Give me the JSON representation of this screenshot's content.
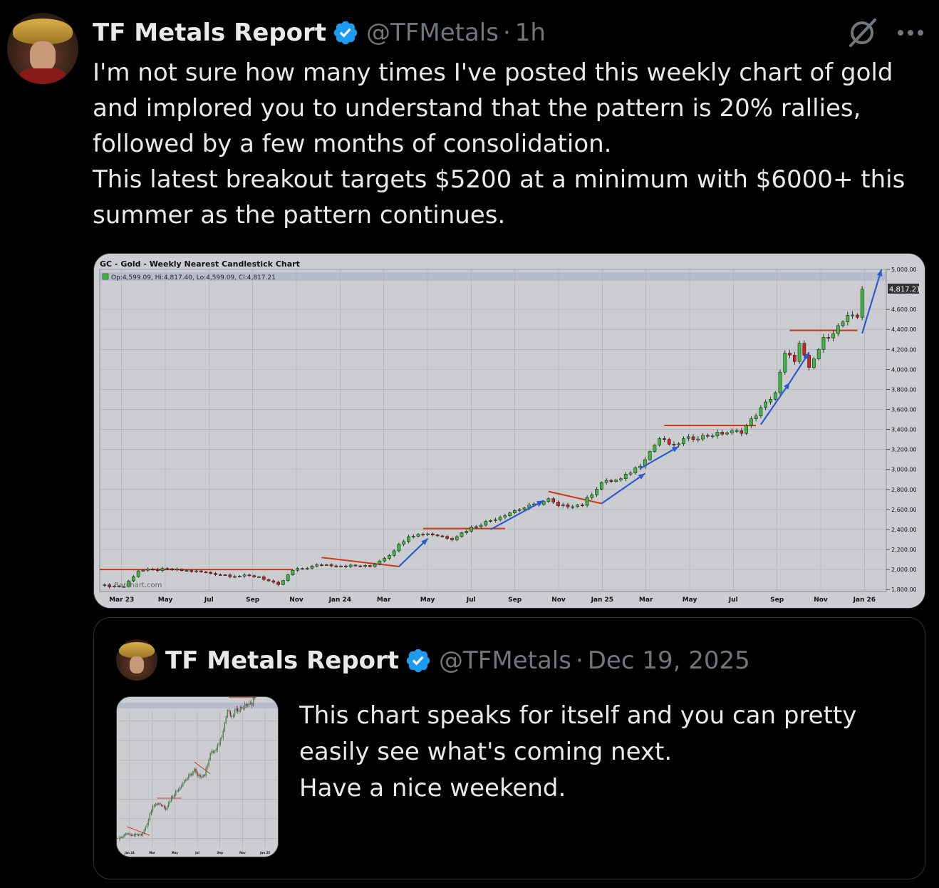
{
  "tweet": {
    "author_name": "TF Metals Report",
    "handle": "@TFMetals",
    "separator": "·",
    "time": "1h",
    "text": "I'm not sure how many times I've posted this weekly chart of gold and implored you to understand that the pattern is 20% rallies, followed by a few months of consolidation.\nThis latest breakout targets $5200 at a minimum with $6000+ this summer as the pattern continues."
  },
  "icons": {
    "verified": "verified-badge-icon",
    "grok": "grok-icon",
    "more": "more-icon"
  },
  "colors": {
    "verified": "#1d9bf0",
    "up_candle": "#3cb83c",
    "down_candle": "#d02020",
    "resistance_line": "#cc3a1a",
    "trend_arrow": "#2a5bd0",
    "muted": "#71767b"
  },
  "chart_data": {
    "type": "candlestick",
    "title": "GC - Gold - Weekly Nearest Candlestick Chart",
    "ohlc_label": "Op:4,599.09, Hi:4,817.40, Lo:4,599.09, Cl:4,817.21",
    "last_price_label": "4,817.21",
    "watermark": "Barchart.com",
    "x_tick_labels": [
      "Mar 23",
      "May",
      "Jul",
      "Sep",
      "Nov",
      "Jan 24",
      "Mar",
      "May",
      "Jul",
      "Sep",
      "Nov",
      "Jan 25",
      "Mar",
      "May",
      "Jul",
      "Sep",
      "Nov",
      "Jan 26"
    ],
    "y_tick_labels": [
      "5,000.00",
      "4,600.00",
      "4,400.00",
      "4,200.00",
      "4,000.00",
      "3,800.00",
      "3,600.00",
      "3,400.00",
      "3,200.00",
      "3,000.00",
      "2,800.00",
      "2,600.00",
      "2,400.00",
      "2,200.00",
      "2,000.00",
      "1,800.00"
    ],
    "y_ticks": [
      5000,
      4600,
      4400,
      4200,
      4000,
      3800,
      3600,
      3400,
      3200,
      3000,
      2800,
      2600,
      2400,
      2200,
      2000,
      1800
    ],
    "ylim": [
      1780,
      5000
    ],
    "weeks": 150,
    "close_anchors": [
      [
        0,
        1840
      ],
      [
        5,
        1830
      ],
      [
        8,
        1990
      ],
      [
        14,
        2000
      ],
      [
        20,
        1980
      ],
      [
        27,
        1940
      ],
      [
        33,
        1930
      ],
      [
        37,
        1840
      ],
      [
        40,
        1990
      ],
      [
        46,
        2050
      ],
      [
        50,
        2040
      ],
      [
        56,
        2030
      ],
      [
        60,
        2150
      ],
      [
        64,
        2340
      ],
      [
        68,
        2360
      ],
      [
        73,
        2310
      ],
      [
        77,
        2420
      ],
      [
        82,
        2510
      ],
      [
        86,
        2590
      ],
      [
        91,
        2660
      ],
      [
        93,
        2700
      ],
      [
        95,
        2630
      ],
      [
        100,
        2650
      ],
      [
        104,
        2870
      ],
      [
        108,
        2900
      ],
      [
        112,
        3050
      ],
      [
        116,
        3310
      ],
      [
        119,
        3230
      ],
      [
        121,
        3300
      ],
      [
        126,
        3340
      ],
      [
        130,
        3370
      ],
      [
        133,
        3380
      ],
      [
        136,
        3550
      ],
      [
        140,
        3770
      ],
      [
        142,
        4150
      ],
      [
        144,
        4100
      ],
      [
        145,
        4250
      ],
      [
        147,
        4000
      ],
      [
        150,
        4300
      ],
      [
        152,
        4380
      ],
      [
        155,
        4520
      ],
      [
        157,
        4520
      ],
      [
        158,
        4817
      ]
    ],
    "resistance_lines": [
      {
        "x0": 0,
        "x1": 40,
        "y": 2000
      },
      {
        "x0": 46,
        "x1": 62,
        "y0": 2120,
        "y1": 2030
      },
      {
        "x0": 67,
        "x1": 84,
        "y": 2410
      },
      {
        "x0": 93,
        "x1": 104,
        "y0": 2780,
        "y1": 2660
      },
      {
        "x0": 117,
        "x1": 136,
        "y": 3440
      },
      {
        "x0": 143,
        "x1": 157,
        "y": 4390
      }
    ],
    "trend_arrows": [
      {
        "x0": 62,
        "y0": 2030,
        "x1": 68,
        "y1": 2310
      },
      {
        "x0": 81,
        "y0": 2400,
        "x1": 92,
        "y1": 2690
      },
      {
        "x0": 104,
        "y0": 2660,
        "x1": 113,
        "y1": 2960
      },
      {
        "x0": 112,
        "y0": 3010,
        "x1": 120,
        "y1": 3230
      },
      {
        "x0": 137,
        "y0": 3450,
        "x1": 143,
        "y1": 3870
      },
      {
        "x0": 143,
        "y0": 3870,
        "x1": 147,
        "y1": 4170
      },
      {
        "x0": 158,
        "y0": 4360,
        "x1": 162,
        "y1": 5000
      }
    ]
  },
  "quote": {
    "author_name": "TF Metals Report",
    "handle": "@TFMetals",
    "separator": "·",
    "date": "Dec 19, 2025",
    "text": "This chart speaks for itself and you can pretty easily see what's coming next.\nHave a nice weekend.",
    "thumb_x_tick_labels": [
      "Jan 24",
      "Mar",
      "May",
      "Jul",
      "Sep",
      "Nov",
      "Jan 25"
    ]
  }
}
